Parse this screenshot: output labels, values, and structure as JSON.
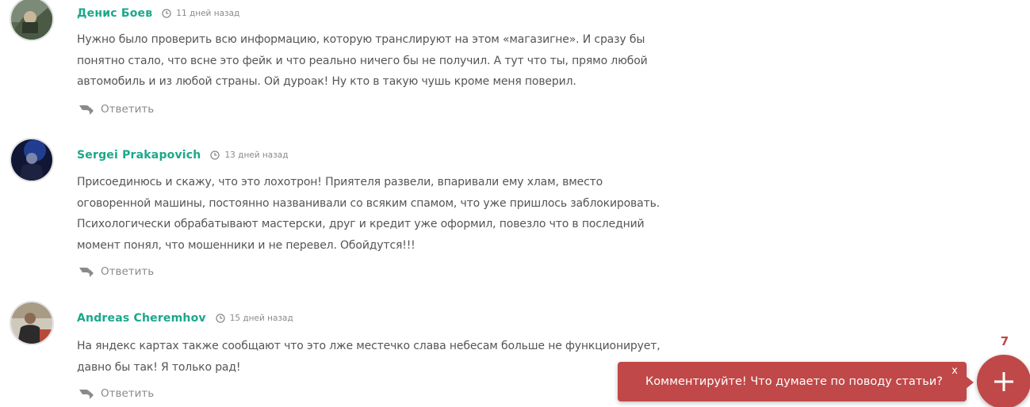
{
  "comments": [
    {
      "author": "Денис Боев",
      "date": "11 дней назад",
      "lines": [
        "Нужно было проверить всю информацию, которую транслируют на этом «магазигне». И сразу бы",
        "понятно стало, что всне это фейк и что реально ничего бы не получил. А тут что ты, прямо любой",
        "автомобиль и из любой страны. Ой дуроак! Ну кто в такую чушь кроме меня поверил."
      ],
      "reply_label": "Ответить"
    },
    {
      "author": "Sergei Prakapovich",
      "date": "13 дней назад",
      "lines": [
        "Присоединюсь и скажу, что это лохотрон! Приятеля развели, впаривали ему хлам, вместо",
        "оговоренной машины, постоянно названивали со всяким спамом, что уже пришлось заблокировать.",
        "Психологически обрабатывают мастерски, друг и кредит уже оформил, повезло что в последний",
        "момент понял, что мошенники и не перевел. Обойдутся!!!"
      ],
      "reply_label": "Ответить"
    },
    {
      "author": "Andreas Cheremhov",
      "date": "15 дней назад",
      "lines": [
        "На яндекс картах также сообщают что это лже местечко слава небесам больше не функционирует,",
        "давно бы так! Я только рад!"
      ],
      "reply_label": "Ответить"
    }
  ],
  "widget": {
    "prompt": "Комментируйте! Что думаете по поводу статьи?",
    "close_label": "x",
    "comment_count": "7"
  },
  "colors": {
    "author": "#1aa88a",
    "widget": "#c04848",
    "text": "#555555",
    "muted": "#8a8a8a"
  },
  "icons": {
    "date": "clock-icon",
    "reply": "reply-arrow-icon",
    "add": "plus-icon"
  }
}
